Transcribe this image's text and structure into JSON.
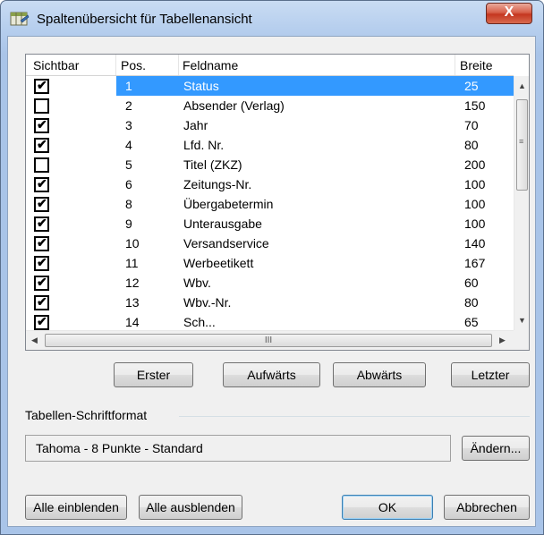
{
  "window": {
    "title": "Spaltenübersicht für Tabellenansicht",
    "close_label": "X"
  },
  "table": {
    "columns": [
      "Sichtbar",
      "Pos.",
      "Feldname",
      "Breite"
    ],
    "rows": [
      {
        "visible": true,
        "pos": "1",
        "name": "Status",
        "width": "25",
        "selected": true
      },
      {
        "visible": false,
        "pos": "2",
        "name": "Absender (Verlag)",
        "width": "150"
      },
      {
        "visible": true,
        "pos": "3",
        "name": "Jahr",
        "width": "70"
      },
      {
        "visible": true,
        "pos": "4",
        "name": "Lfd. Nr.",
        "width": "80"
      },
      {
        "visible": false,
        "pos": "5",
        "name": "Titel (ZKZ)",
        "width": "200"
      },
      {
        "visible": true,
        "pos": "6",
        "name": "Zeitungs-Nr.",
        "width": "100"
      },
      {
        "visible": true,
        "pos": "8",
        "name": "Übergabetermin",
        "width": "100"
      },
      {
        "visible": true,
        "pos": "9",
        "name": "Unterausgabe",
        "width": "100"
      },
      {
        "visible": true,
        "pos": "10",
        "name": "Versandservice",
        "width": "140"
      },
      {
        "visible": true,
        "pos": "11",
        "name": "Werbeetikett",
        "width": "167"
      },
      {
        "visible": true,
        "pos": "12",
        "name": "Wbv.",
        "width": "60"
      },
      {
        "visible": true,
        "pos": "13",
        "name": "Wbv.-Nr.",
        "width": "80"
      },
      {
        "visible": true,
        "pos": "14",
        "name": "Sch...",
        "width": "65"
      }
    ],
    "hscroll_grip": "III"
  },
  "move_buttons": {
    "first": "Erster",
    "up": "Aufwärts",
    "down": "Abwärts",
    "last": "Letzter"
  },
  "font_group": {
    "label": "Tabellen-Schriftformat",
    "value": "Tahoma - 8 Punkte - Standard",
    "change_button": "Ändern..."
  },
  "footer": {
    "show_all": "Alle einblenden",
    "hide_all": "Alle ausblenden",
    "ok": "OK",
    "cancel": "Abbrechen"
  },
  "icons": {
    "title": "table-columns-icon",
    "check": "✔"
  },
  "colors": {
    "selection": "#3399ff",
    "close_button": "#c4361f",
    "titlebar": "#b7cfee"
  }
}
